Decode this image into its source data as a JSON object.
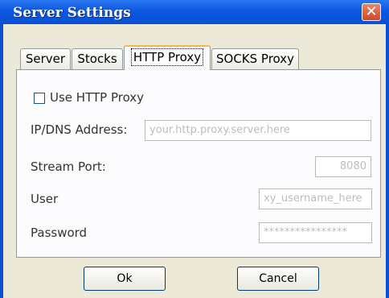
{
  "window": {
    "title": "Server Settings",
    "close_glyph": "✕",
    "close_icon": "close-icon"
  },
  "tabs": [
    {
      "label": "Server"
    },
    {
      "label": "Stocks"
    },
    {
      "label": "HTTP Proxy",
      "active": true
    },
    {
      "label": "SOCKS Proxy"
    }
  ],
  "proxy": {
    "use_http_proxy_label": "Use HTTP Proxy",
    "use_http_proxy_checked": false,
    "address_label": "IP/DNS Address:",
    "address_value": "your.http.proxy.server.here",
    "port_label": "Stream Port:",
    "port_value": "8080",
    "user_label": "User",
    "user_value": "xy_username_here",
    "password_label": "Password",
    "password_value": "****************"
  },
  "buttons": {
    "ok": "Ok",
    "cancel": "Cancel"
  }
}
